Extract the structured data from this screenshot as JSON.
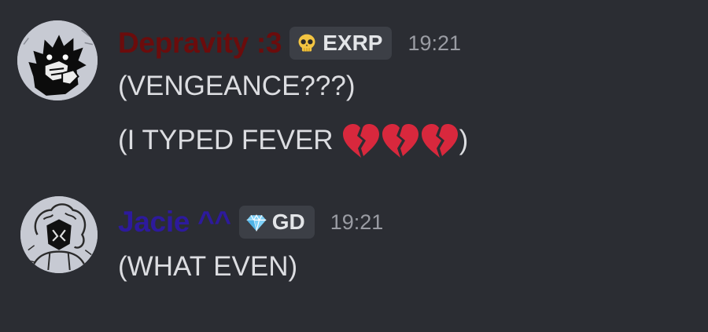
{
  "messages": [
    {
      "username": "Depravity :3",
      "username_color": "#6b0c0c",
      "role": {
        "label": "EXRP",
        "icon": "skull-icon"
      },
      "timestamp": "19:21",
      "lines": [
        {
          "text": "(VENGEANCE???)"
        },
        {
          "prefix": "(I TYPED FEVER",
          "emoji": [
            "broken-heart-icon",
            "broken-heart-icon",
            "broken-heart-icon"
          ],
          "suffix": ")"
        }
      ]
    },
    {
      "username": "Jacie ^^",
      "username_color": "#2d1a9c",
      "role": {
        "label": "GD",
        "icon": "gem-icon"
      },
      "timestamp": "19:21",
      "lines": [
        {
          "text": "(WHAT EVEN)"
        }
      ]
    }
  ],
  "colors": {
    "background": "#2b2d33",
    "message_text": "#dcdde1",
    "timestamp": "#9a9ca3",
    "badge_bg": "#3c3f46",
    "heart": "#d8283d"
  }
}
